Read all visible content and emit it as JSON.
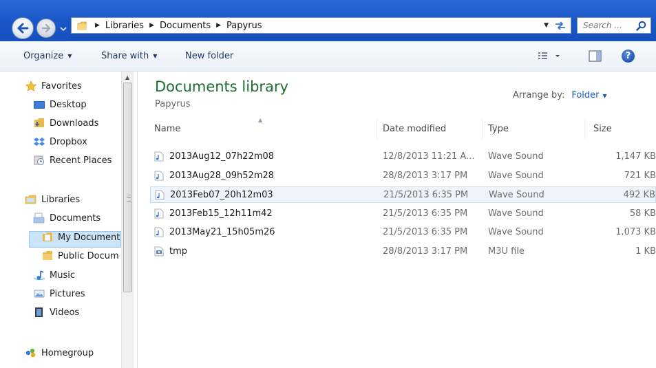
{
  "navigation": {
    "breadcrumb": [
      "Libraries",
      "Documents",
      "Papyrus"
    ],
    "search_placeholder": "Search ..."
  },
  "toolbar": {
    "organize_label": "Organize",
    "share_label": "Share with",
    "new_folder_label": "New folder",
    "help_label": "?"
  },
  "sidebar": {
    "favorites": {
      "label": "Favorites",
      "items": [
        {
          "label": "Desktop",
          "icon": "desktop-icon"
        },
        {
          "label": "Downloads",
          "icon": "downloads-folder-icon"
        },
        {
          "label": "Dropbox",
          "icon": "dropbox-icon"
        },
        {
          "label": "Recent Places",
          "icon": "recent-places-icon"
        }
      ]
    },
    "libraries": {
      "label": "Libraries",
      "documents": "Documents",
      "my_documents": "My Document",
      "public_documents": "Public Docum",
      "music": "Music",
      "pictures": "Pictures",
      "videos": "Videos"
    },
    "homegroup": "Homegroup"
  },
  "library": {
    "title": "Documents library",
    "subtitle": "Papyrus",
    "arrange_label": "Arrange by:",
    "arrange_value": "Folder"
  },
  "columns": {
    "name": "Name",
    "date": "Date modified",
    "type": "Type",
    "size": "Size"
  },
  "files": [
    {
      "name": "2013Aug12_07h22m08",
      "date": "12/8/2013 11:21 A...",
      "type": "Wave Sound",
      "size": "1,147 KB",
      "icon": "wave-file-icon"
    },
    {
      "name": "2013Aug28_09h52m28",
      "date": "28/8/2013 3:17 PM",
      "type": "Wave Sound",
      "size": "721 KB",
      "icon": "wave-file-icon"
    },
    {
      "name": "2013Feb07_20h12m03",
      "date": "21/5/2013 6:35 PM",
      "type": "Wave Sound",
      "size": "492 KB",
      "icon": "wave-file-icon"
    },
    {
      "name": "2013Feb15_12h11m42",
      "date": "21/5/2013 6:35 PM",
      "type": "Wave Sound",
      "size": "58 KB",
      "icon": "wave-file-icon"
    },
    {
      "name": "2013May21_15h05m26",
      "date": "21/5/2013 6:35 PM",
      "type": "Wave Sound",
      "size": "1,073 KB",
      "icon": "wave-file-icon"
    },
    {
      "name": "tmp",
      "date": "28/8/2013 3:17 PM",
      "type": "M3U file",
      "size": "1 KB",
      "icon": "m3u-file-icon"
    }
  ],
  "colors": {
    "title_bar": "#1a57c8",
    "library_title": "#1e6e2e",
    "arrange_link": "#1e5bb8",
    "selection": "#cce4f7"
  }
}
